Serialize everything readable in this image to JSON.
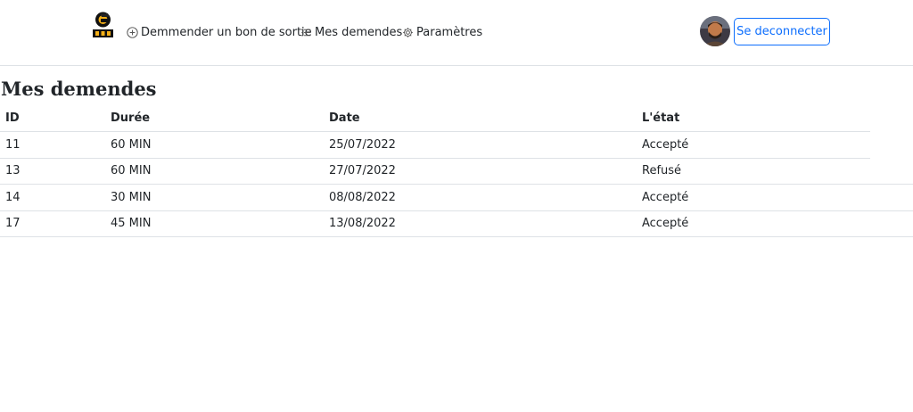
{
  "navbar": {
    "logo_text": "GCB",
    "links": [
      {
        "label": "Demmender un bon de sortie",
        "icon": "plus-circle-icon"
      },
      {
        "label": "Mes demendes",
        "icon": "list-icon"
      },
      {
        "label": "Paramètres",
        "icon": "gear-icon"
      }
    ],
    "logout_label": "Se deconnecter",
    "accent_color": "#0d6efd"
  },
  "page": {
    "title": "Mes demendes"
  },
  "table": {
    "columns": [
      "ID",
      "Durée",
      "Date",
      "L'état"
    ],
    "rows": [
      [
        "11",
        "60 MIN",
        "25/07/2022",
        "Accepté"
      ],
      [
        "13",
        "60 MIN",
        "27/07/2022",
        "Refusé"
      ],
      [
        "14",
        "30 MIN",
        "08/08/2022",
        "Accepté"
      ],
      [
        "17",
        "45 MIN",
        "13/08/2022",
        "Accepté"
      ]
    ]
  }
}
